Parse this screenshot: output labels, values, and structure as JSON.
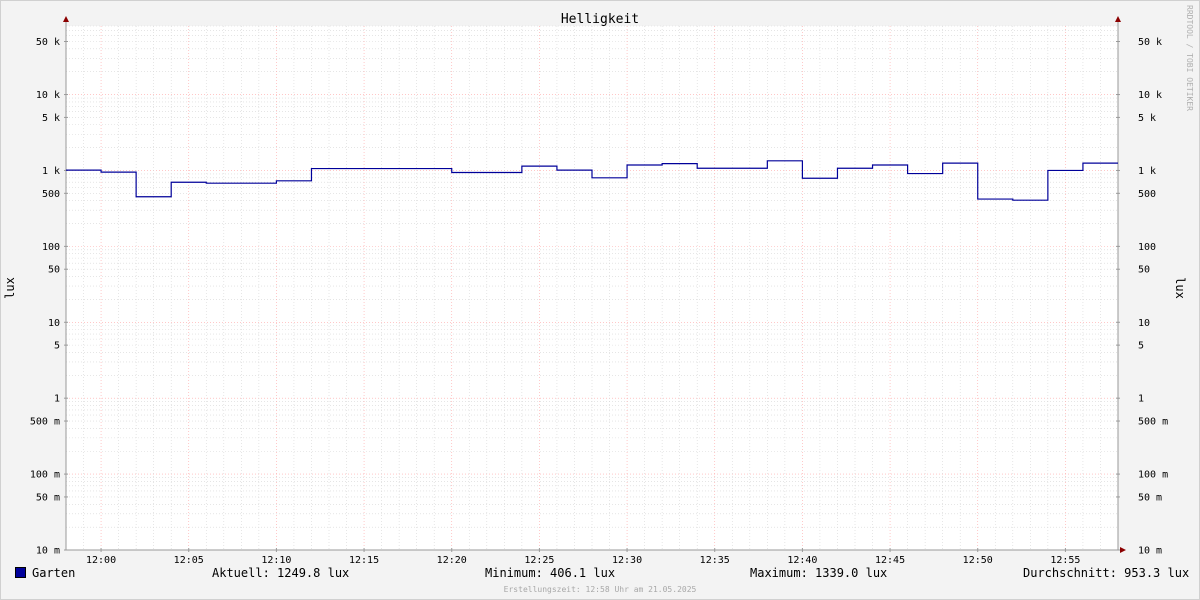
{
  "chart_data": {
    "type": "line",
    "title": "Helligkeit",
    "ylabel": "lux",
    "ylabel_right": "lux",
    "y_scale": "log",
    "ylim": [
      10,
      80000
    ],
    "y_ticks": [
      {
        "value": 50000,
        "label": "50 k"
      },
      {
        "value": 10000,
        "label": "10 k"
      },
      {
        "value": 5000,
        "label": "5 k"
      },
      {
        "value": 1000,
        "label": "1 k"
      },
      {
        "value": 500,
        "label": "500"
      },
      {
        "value": 100,
        "label": "100"
      },
      {
        "value": 50,
        "label": "50"
      },
      {
        "value": 10,
        "label": "10"
      },
      {
        "value": 5,
        "label": "5"
      },
      {
        "value": 1,
        "label": "1"
      },
      {
        "value": 0.5,
        "label": "500 m"
      },
      {
        "value": 0.1,
        "label": "100 m"
      },
      {
        "value": 0.05,
        "label": "50 m"
      },
      {
        "value": 0.01,
        "label": "10 m"
      }
    ],
    "x_ticks": [
      "12:00",
      "12:05",
      "12:10",
      "12:15",
      "12:20",
      "12:25",
      "12:30",
      "12:35",
      "12:40",
      "12:45",
      "12:50",
      "12:55"
    ],
    "x_range": [
      "11:58",
      "12:58"
    ],
    "grid": true,
    "series": [
      {
        "name": "Garten",
        "color": "#00009a",
        "step": "post",
        "x": [
          "11:58",
          "12:00",
          "12:02",
          "12:04",
          "12:06",
          "12:08",
          "12:10",
          "12:12",
          "12:14",
          "12:16",
          "12:18",
          "12:20",
          "12:22",
          "12:24",
          "12:26",
          "12:28",
          "12:30",
          "12:32",
          "12:34",
          "12:36",
          "12:38",
          "12:40",
          "12:42",
          "12:44",
          "12:46",
          "12:48",
          "12:50",
          "12:52",
          "12:54",
          "12:56",
          "12:58"
        ],
        "values": [
          1010,
          950,
          450,
          700,
          680,
          680,
          730,
          1060,
          1060,
          1060,
          1060,
          940,
          940,
          1140,
          1010,
          800,
          1180,
          1230,
          1070,
          1070,
          1339,
          790,
          1070,
          1180,
          910,
          1250,
          420,
          406.1,
          1000,
          1249.8,
          1249.8
        ]
      }
    ]
  },
  "legend": {
    "series_name": "Garten",
    "series_color": "#00009a",
    "current": "Aktuell: 1249.8 lux",
    "minimum": "Minimum: 406.1 lux",
    "maximum": "Maximum: 1339.0 lux",
    "average": "Durchschnitt: 953.3 lux"
  },
  "footer": "Erstellungszeit: 12:58 Uhr am 21.05.2025",
  "credit": "RRDTOOL / TOBI OETIKER"
}
